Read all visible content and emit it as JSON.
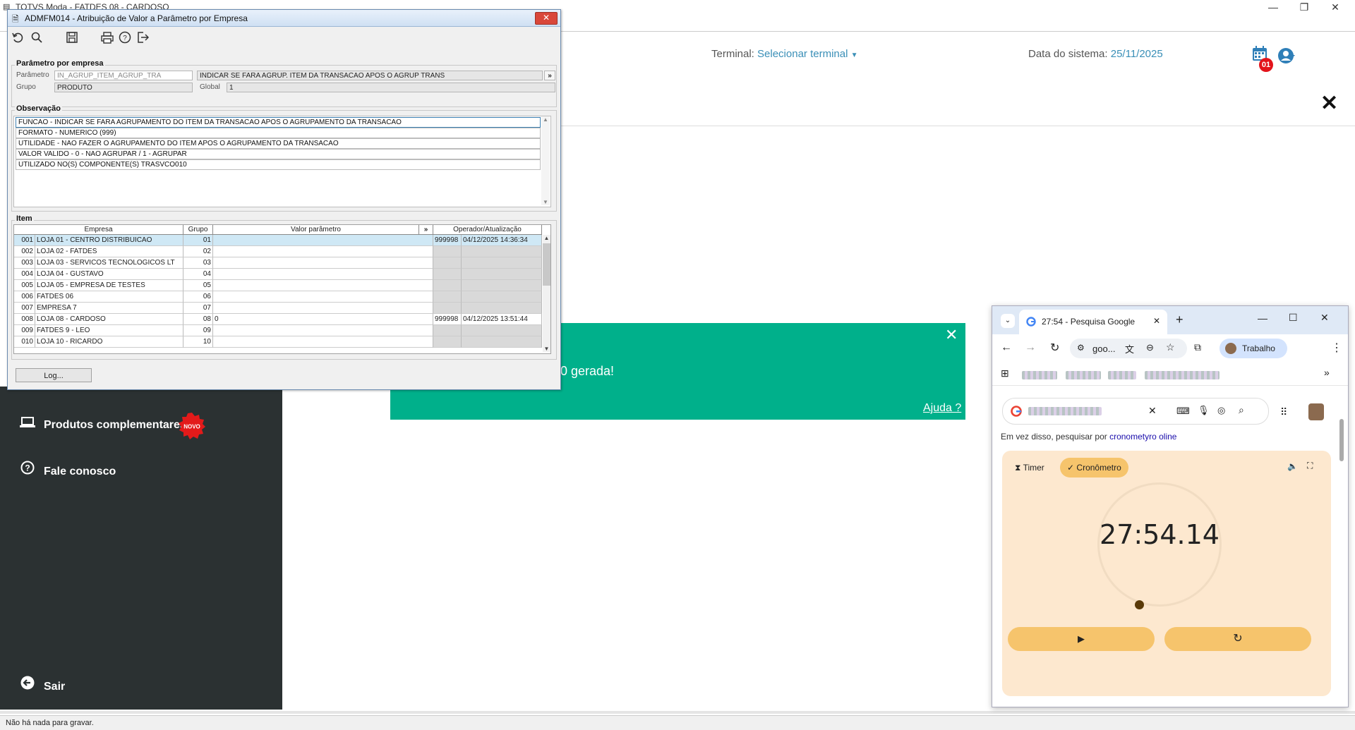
{
  "app": {
    "title": "TOTVS Moda - FATDES 08 - CARDOSO",
    "window_controls": {
      "minimize": "—",
      "restore": "❐"
    }
  },
  "header": {
    "terminal_label": "Terminal:",
    "terminal_value": "Selecionar terminal",
    "date_label": "Data do sistema:",
    "date_value": "25/11/2025",
    "calendar_badge": "01"
  },
  "sidebar": {
    "items": [
      {
        "label": "Produtos complementares",
        "icon": "laptop-icon"
      },
      {
        "label": "Fale conosco",
        "icon": "help-circle-icon"
      },
      {
        "label": "Sair",
        "icon": "exit-arrow-icon"
      }
    ],
    "novo_badge": "NOVO"
  },
  "toast": {
    "text": "0 gerada!",
    "help_link": "Ajuda ?",
    "color": "#00b08b"
  },
  "statusbar": {
    "text": "Não há nada para gravar."
  },
  "dialog": {
    "title": "ADMFM014 - Atribuição de Valor a Parâmetro por Empresa",
    "section_param": "Parâmetro por empresa",
    "param_label": "Parâmetro",
    "param_code": "IN_AGRUP_ITEM_AGRUP_TRA",
    "param_desc": "INDICAR SE FARA AGRUP. ITEM DA TRANSACAO APOS O AGRUP TRANS",
    "expand_button": "»",
    "group_label": "Grupo",
    "group_value": "PRODUTO",
    "global_label": "Global",
    "global_value": "1",
    "section_obs": "Observação",
    "obs_lines": [
      "FUNCAO - INDICAR SE FARA AGRUPAMENTO DO ITEM DA TRANSACAO APOS O AGRUPAMENTO DA TRANSACAO",
      "FORMATO - NUMERICO (999)",
      "UTILIDADE - NAO FAZER O AGRUPAMENTO DO ITEM APOS O AGRUPAMENTO DA TRANSACAO",
      "VALOR VALIDO -  0 - NAO AGRUPAR / 1 - AGRUPAR",
      "UTILIZADO NO(S) COMPONENTE(S) TRASVCO010"
    ],
    "section_item": "Item",
    "grid_headers": {
      "empresa": "Empresa",
      "grupo": "Grupo",
      "valor": "Valor parâmetro",
      "expand": "»",
      "operador": "Operador/Atualização"
    },
    "rows": [
      {
        "code": "001",
        "name": "LOJA 01 - CENTRO DISTRIBUICAO",
        "grupo": "01",
        "valor": "",
        "op": "999998",
        "data": "04/12/2025 14:36:34"
      },
      {
        "code": "002",
        "name": "LOJA 02 - FATDES",
        "grupo": "02",
        "valor": "",
        "op": "",
        "data": ""
      },
      {
        "code": "003",
        "name": "LOJA 03 - SERVICOS TECNOLOGICOS LT",
        "grupo": "03",
        "valor": "",
        "op": "",
        "data": ""
      },
      {
        "code": "004",
        "name": "LOJA 04 - GUSTAVO",
        "grupo": "04",
        "valor": "",
        "op": "",
        "data": ""
      },
      {
        "code": "005",
        "name": "LOJA 05 - EMPRESA DE TESTES",
        "grupo": "05",
        "valor": "",
        "op": "",
        "data": ""
      },
      {
        "code": "006",
        "name": "FATDES 06",
        "grupo": "06",
        "valor": "",
        "op": "",
        "data": ""
      },
      {
        "code": "007",
        "name": "EMPRESA 7",
        "grupo": "07",
        "valor": "",
        "op": "",
        "data": ""
      },
      {
        "code": "008",
        "name": "LOJA 08 - CARDOSO",
        "grupo": "08",
        "valor": "0",
        "op": "999998",
        "data": "04/12/2025 13:51:44"
      },
      {
        "code": "009",
        "name": "FATDES 9 - LEO",
        "grupo": "09",
        "valor": "",
        "op": "",
        "data": ""
      },
      {
        "code": "010",
        "name": "LOJA 10 - RICARDO",
        "grupo": "10",
        "valor": "",
        "op": "",
        "data": ""
      }
    ],
    "log_button": "Log..."
  },
  "chrome": {
    "tab_title": "27:54 - Pesquisa Google",
    "address": "goo...",
    "profile": "Trabalho",
    "suggestion_prefix": "Em vez disso, pesquisar por",
    "suggestion_link": "cronometyro oline",
    "widget_tab_timer": "Timer",
    "widget_tab_stopwatch": "Cronômetro",
    "stopwatch_time": "27:54.14",
    "play_icon": "▶",
    "reset_icon": "↻"
  }
}
